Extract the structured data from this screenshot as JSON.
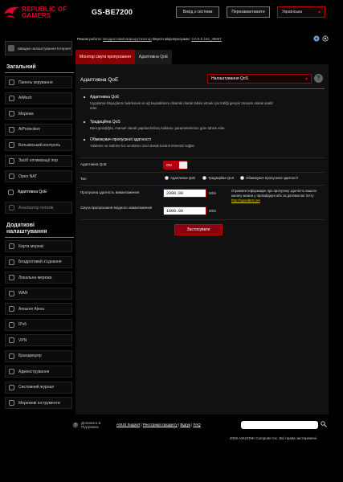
{
  "header": {
    "brand_line1": "REPUBLIC OF",
    "brand_line2": "GAMERS",
    "model": "GS-BE7200",
    "logout_label": "Вихід з системи",
    "reboot_label": "Перезавантажити",
    "language": "Українська"
  },
  "infobar": {
    "mode_prefix": "Режим роботи:",
    "mode_value": "Бездротовий маршрутизатор",
    "fw_prefix": "Версія мікропрограми:",
    "fw_value": "3.0.0.6.102_38857"
  },
  "sidebar": {
    "qis_label": "Швидке налаштування Інтернет",
    "general_title": "Загальний",
    "general_items": [
      {
        "label": "Панель керування",
        "icon": "dashboard-icon"
      },
      {
        "label": "AiMesh",
        "icon": "mesh-icon"
      },
      {
        "label": "Мережа",
        "icon": "network-icon"
      },
      {
        "label": "AiProtection",
        "icon": "shield-icon"
      },
      {
        "label": "Батьківський контроль",
        "icon": "parental-icon"
      },
      {
        "label": "Засіб оптимізації ігор",
        "icon": "game-icon"
      },
      {
        "label": "Open NAT",
        "icon": "nat-icon"
      },
      {
        "label": "Адаптивна QoE",
        "icon": "qoe-icon"
      },
      {
        "label": "Аналізатор потоків",
        "icon": "traffic-icon"
      }
    ],
    "advanced_title": "Додаткові налаштування",
    "advanced_items": [
      {
        "label": "Карта мережі",
        "icon": "map-icon"
      },
      {
        "label": "Бездротовий з'єднання",
        "icon": "wireless-icon"
      },
      {
        "label": "Локальна мережа",
        "icon": "lan-icon"
      },
      {
        "label": "WAN",
        "icon": "wan-icon"
      },
      {
        "label": "Amazon Alexa",
        "icon": "alexa-icon"
      },
      {
        "label": "IPv6",
        "icon": "ipv6-icon"
      },
      {
        "label": "VPN",
        "icon": "vpn-icon"
      },
      {
        "label": "Брандмауер",
        "icon": "firewall-icon"
      },
      {
        "label": "Адміністрування",
        "icon": "admin-icon"
      },
      {
        "label": "Системний журнал",
        "icon": "log-icon"
      },
      {
        "label": "Мережеві інструменти",
        "icon": "tools-icon"
      }
    ]
  },
  "tabs": [
    "Монітор смуги пропускання",
    "Адаптивна QoE"
  ],
  "panel": {
    "title": "Адаптивна QoE",
    "mode_select": "Налаштування QoS",
    "descriptions": [
      {
        "heading": "Адаптивна QoE",
        "text": "Uygulama ihtiyaçlarını belirlemek ve ağ kaynaklarını dinamik olarak tahsis etmek için trafiği gerçek zamanlı olarak analiz eder."
      },
      {
        "heading": "Традиційна QoS",
        "text": "Bant genişliğini, manuel olarak yapılandırılmış kullanıcı parametrelerine göre tahsis eder."
      },
      {
        "heading": "Обмежувач пропускної здатності",
        "text": "Yükleme ve indirme hız sınırlarını özel olarak kontrol etmenizi sağlar."
      }
    ],
    "enable_label": "Адаптивна QoE",
    "toggle_state": "ON",
    "type_label": "Тип",
    "type_options": [
      "Адаптивна QoE",
      "Традиційна QoS",
      "Обмежувач пропускної здатності"
    ],
    "type_selected": "Традиційна QoS",
    "upload_label": "Пропускна здатність вивантаження",
    "upload_value": "2000.00",
    "download_label": "Смуга пропускання вхідного завантаження",
    "download_value": "1000.00",
    "unit": "Mb/s",
    "note_text": "Отримати інформацію про пропускну здатність вашого каналу можна у провайдера або за допомогою тесту",
    "note_link": "http://speedtest.net",
    "apply_label": "Застосувати"
  },
  "footer": {
    "help_label": "Допомога & Підтримка",
    "links": [
      "ASUS Support",
      "Реєстрація продукту",
      "Відгук",
      "FAQ"
    ],
    "copyright": "2026 ASUSTeK Computer Inc. Всі права застережені."
  },
  "colors": {
    "accent": "#e0002a",
    "active_tab": "#8a0000",
    "link": "#e8d200"
  }
}
